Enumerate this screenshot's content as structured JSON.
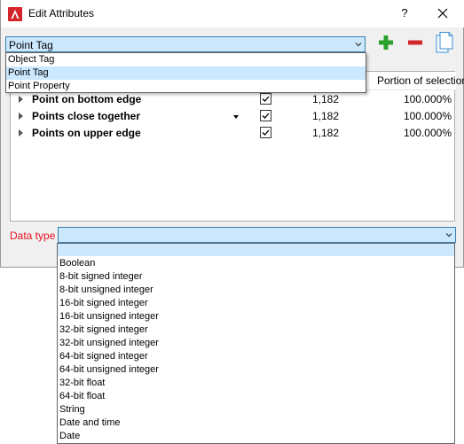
{
  "window": {
    "title": "Edit Attributes",
    "help_label": "?"
  },
  "category_select": {
    "value": "Point Tag",
    "options": [
      "Object Tag",
      "Point Tag",
      "Point Property"
    ],
    "selected_index": 1
  },
  "table": {
    "col_header": "Portion of selection",
    "rows": [
      {
        "name": "Point on bottom edge",
        "checked": true,
        "count": "1,182",
        "portion": "100.000%"
      },
      {
        "name": "Points close together",
        "checked": true,
        "count": "1,182",
        "portion": "100.000%"
      },
      {
        "name": "Points on upper edge",
        "checked": true,
        "count": "1,182",
        "portion": "100.000%"
      }
    ]
  },
  "data_type": {
    "label": "Data type",
    "value": "",
    "options": [
      "Boolean",
      "8-bit signed integer",
      "8-bit unsigned integer",
      "16-bit signed integer",
      "16-bit unsigned integer",
      "32-bit signed integer",
      "32-bit unsigned integer",
      "64-bit signed integer",
      "64-bit unsigned integer",
      "32-bit float",
      "64-bit float",
      "String",
      "Date and time",
      "Date"
    ]
  },
  "colors": {
    "accent": "#cce8ff",
    "add": "#2aa12a",
    "remove": "#d4252b",
    "label_red": "#e81123"
  },
  "icons": {
    "add": "plus-icon",
    "remove": "minus-icon",
    "copy": "copy-document-icon"
  }
}
